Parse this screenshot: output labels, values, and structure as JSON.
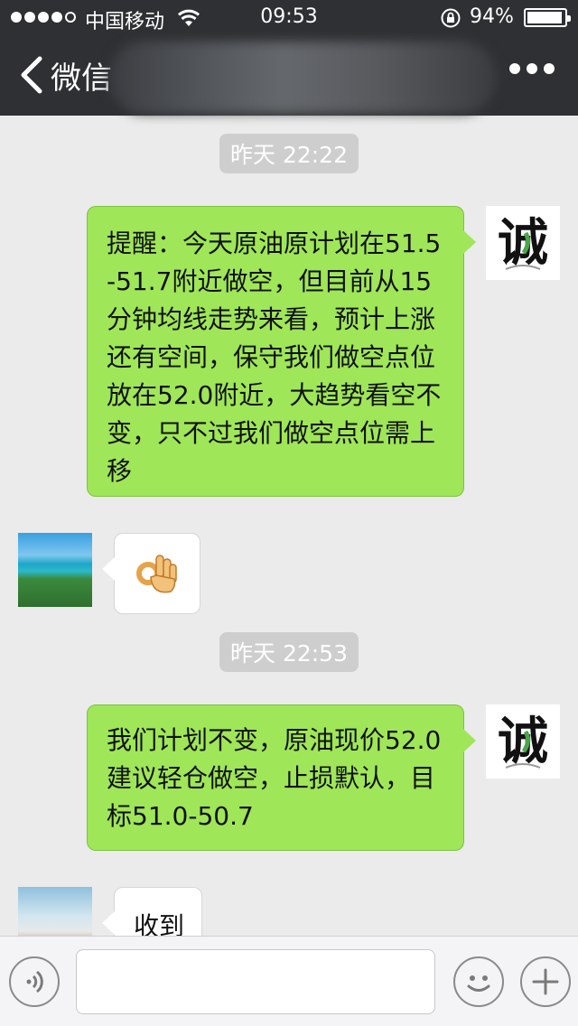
{
  "status_bar": {
    "carrier": "中国移动",
    "time": "09:53",
    "battery_percent": "94%",
    "battery_level": 0.94,
    "signal_bars_filled": 4,
    "signal_bars_total": 5
  },
  "nav": {
    "back_label": "微信",
    "more_icon": "more-dots-icon"
  },
  "messages": [
    {
      "type": "timestamp",
      "text": "昨天 22:22"
    },
    {
      "type": "text",
      "sender": "me",
      "text": "提醒：今天原油原计划在51.5-51.7附近做空，但目前从15分钟均线走势来看，预计上涨还有空间，保守我们做空点位放在52.0附近，大趋势看空不变，只不过我们做空点位需上移"
    },
    {
      "type": "emoji",
      "sender": "other",
      "icon": "ok-hand-icon"
    },
    {
      "type": "timestamp",
      "text": "昨天 22:53"
    },
    {
      "type": "text",
      "sender": "me",
      "text": "我们计划不变，原油现价52.0建议轻仓做空，止损默认，目标51.0-50.7"
    },
    {
      "type": "text",
      "sender": "other",
      "text": "收到"
    }
  ],
  "avatar_logo_char": "诚",
  "input_bar": {
    "voice_icon": "voice-icon",
    "emoji_icon": "emoji-icon",
    "plus_icon": "plus-icon",
    "text_value": ""
  },
  "colors": {
    "header_bg": "#2e3033",
    "chat_bg": "#ebebeb",
    "my_bubble": "#9fe658",
    "other_bubble": "#ffffff",
    "timestamp_bg": "#cecece"
  }
}
